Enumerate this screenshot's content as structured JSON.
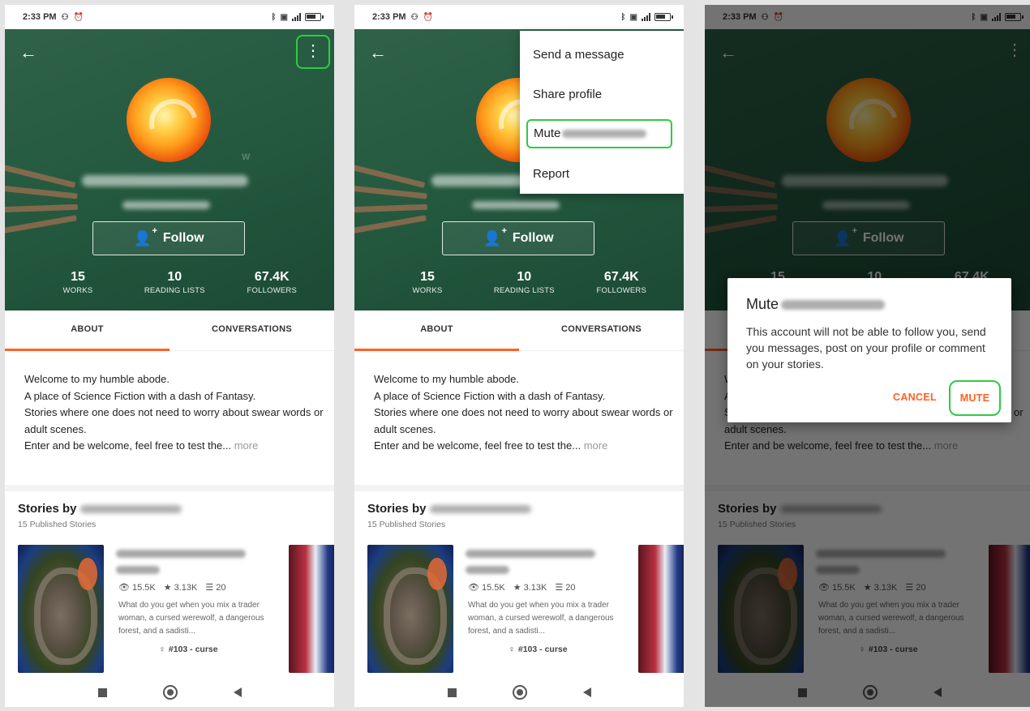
{
  "status": {
    "time": "2:33 PM"
  },
  "profile": {
    "follow_label": "Follow",
    "stats": [
      {
        "value": "15",
        "label": "WORKS"
      },
      {
        "value": "10",
        "label": "READING LISTS"
      },
      {
        "value": "67.4K",
        "label": "FOLLOWERS"
      }
    ]
  },
  "tabs": [
    {
      "label": "ABOUT"
    },
    {
      "label": "CONVERSATIONS"
    }
  ],
  "about": {
    "lines": [
      "Welcome to my humble abode.",
      "A place of Science Fiction with a dash of Fantasy.",
      "Stories where one does not need to worry about swear words or adult scenes.",
      "Enter and be welcome, feel free to test the..."
    ],
    "more_label": "more"
  },
  "stories": {
    "title_prefix": "Stories by",
    "subtitle": "15 Published Stories",
    "item": {
      "reads": "15.5K",
      "votes": "3.13K",
      "parts": "20",
      "description": "What do you get when you mix a trader woman, a cursed werewolf, a dangerous forest, and a sadisti...",
      "tag": "#103 - curse"
    }
  },
  "menu": {
    "items": [
      {
        "label": "Send a message"
      },
      {
        "label": "Share profile"
      },
      {
        "label": "Mute"
      },
      {
        "label": "Report"
      }
    ]
  },
  "dialog": {
    "title": "Mute",
    "body": "This account will not be able to follow you, send you messages, post on your profile or comment on your stories.",
    "cancel_label": "CANCEL",
    "mute_label": "MUTE"
  },
  "colors": {
    "accent": "#ff6122",
    "header_green": "#255a40",
    "highlight": "#2ecc40"
  }
}
